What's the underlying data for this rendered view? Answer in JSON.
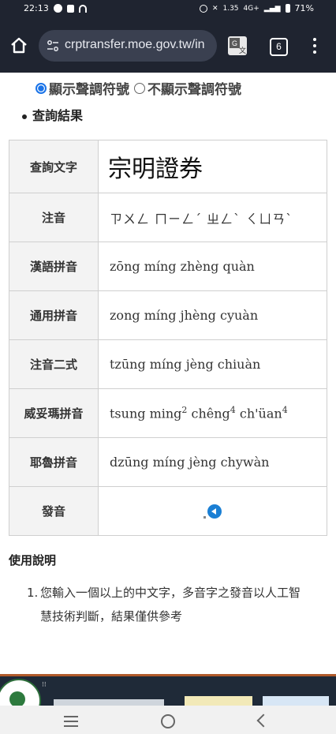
{
  "status_bar": {
    "time": "22:13",
    "network_speed": "1.35",
    "network": "4G+",
    "battery": "71%"
  },
  "browser": {
    "url": "crptransfer.moe.gov.tw/in",
    "tab_count": "6"
  },
  "options": {
    "show_tones_label": "顯示聲調符號",
    "hide_tones_label": "不顯示聲調符號",
    "selected": "show_tones"
  },
  "results": {
    "heading": "查詢結果",
    "rows": [
      {
        "label": "查詢文字",
        "value": "宗明證券"
      },
      {
        "label": "注音",
        "value": "ㄗㄨㄥ ㄇㄧㄥˊ ㄓㄥˋ ㄑㄩㄢˋ"
      },
      {
        "label": "漢語拼音",
        "value": "zōng míng zhèng quàn"
      },
      {
        "label": "通用拼音",
        "value": "zong míng jhèng cyuàn"
      },
      {
        "label": "注音二式",
        "value": "tzūng míng jèng chiuàn"
      },
      {
        "label": "威妥瑪拼音",
        "parts": [
          "tsung ming",
          "2",
          " chêng",
          "4",
          " ch'üan",
          "4"
        ]
      },
      {
        "label": "耶魯拼音",
        "value": "dzūng míng jèng chywàn"
      },
      {
        "label": "發音",
        "icon": "speaker-icon"
      }
    ]
  },
  "usage": {
    "title": "使用說明",
    "items": [
      {
        "number": "1.",
        "text": "您輸入一個以上的中文字，多音字之發音以人工智慧技術判斷，結果僅供參考"
      }
    ]
  },
  "colors": {
    "chrome_bg": "#1f2430",
    "accent_blue": "#1a73e8",
    "footer_bg": "#1f2a38"
  }
}
